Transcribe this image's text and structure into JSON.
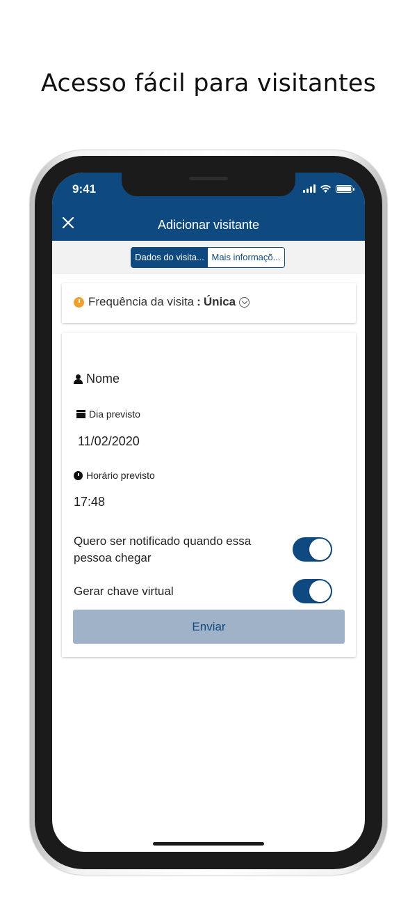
{
  "headline": "Acesso fácil para visitantes",
  "status_bar": {
    "time": "9:41"
  },
  "header": {
    "title": "Adicionar visitante"
  },
  "tabs": [
    {
      "label": "Dados do visita...",
      "active": true
    },
    {
      "label": "Mais informaçõ...",
      "active": false
    }
  ],
  "frequency": {
    "label": "Frequência da visita",
    "separator": ":",
    "value": "Única"
  },
  "form": {
    "name_label": "Nome",
    "date_label": "Dia previsto",
    "date_value": "11/02/2020",
    "time_label": "Horário previsto",
    "time_value": "17:48",
    "notify_label": "Quero ser notificado quando essa pessoa chegar",
    "notify_on": true,
    "key_label": "Gerar chave virtual",
    "key_on": true,
    "submit_label": "Enviar"
  },
  "colors": {
    "primary": "#0e4a80",
    "button_bg": "#a0b2c7",
    "accent": "#f0a030"
  }
}
